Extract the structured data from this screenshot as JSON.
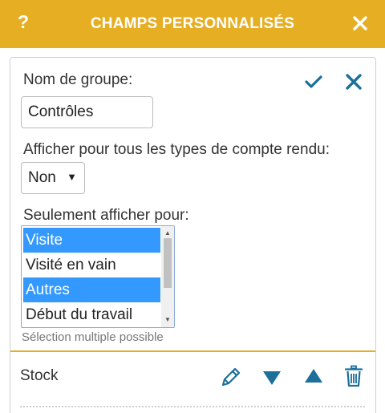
{
  "header": {
    "help_label": "?",
    "title": "CHAMPS PERSONNALISÉS",
    "close_icon": "close-icon"
  },
  "form": {
    "group_name_label": "Nom de groupe:",
    "group_name_value": "Contrôles",
    "display_all_label": "Afficher pour tous les types de compte rendu:",
    "display_all_value": "Non",
    "only_for_label": "Seulement afficher pour:",
    "options": [
      {
        "label": "Visite",
        "selected": true
      },
      {
        "label": "Visité en vain",
        "selected": false
      },
      {
        "label": "Autres",
        "selected": true
      },
      {
        "label": "Début du travail",
        "selected": false
      }
    ],
    "hint": "Sélection multiple possible"
  },
  "field_row": {
    "label": "Stock"
  },
  "colors": {
    "accent": "#e6ae23",
    "icon": "#1b6f9a",
    "selection": "#3399ff"
  }
}
